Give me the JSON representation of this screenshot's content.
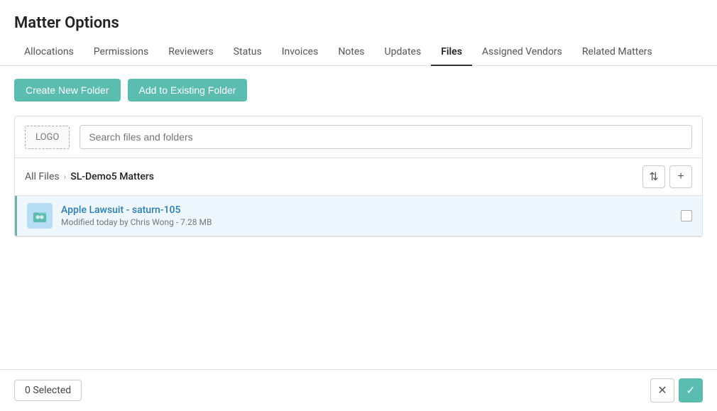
{
  "page": {
    "title": "Matter Options"
  },
  "tabs": {
    "items": [
      {
        "label": "Allocations",
        "active": false
      },
      {
        "label": "Permissions",
        "active": false
      },
      {
        "label": "Reviewers",
        "active": false
      },
      {
        "label": "Status",
        "active": false
      },
      {
        "label": "Invoices",
        "active": false
      },
      {
        "label": "Notes",
        "active": false
      },
      {
        "label": "Updates",
        "active": false
      },
      {
        "label": "Files",
        "active": true
      },
      {
        "label": "Assigned Vendors",
        "active": false
      },
      {
        "label": "Related Matters",
        "active": false
      }
    ]
  },
  "actions": {
    "create_folder_label": "Create New Folder",
    "add_folder_label": "Add to Existing Folder"
  },
  "file_panel": {
    "logo_label": "LOGO",
    "search_placeholder": "Search files and folders",
    "breadcrumb": {
      "root": "All Files",
      "current": "SL-Demo5 Matters"
    },
    "file": {
      "name": "Apple Lawsuit - saturn-105",
      "meta": "Modified today by Chris Wong - 7.28 MB"
    }
  },
  "footer": {
    "selected_count": "0",
    "selected_label": "Selected"
  },
  "icons": {
    "sort": "⇅",
    "plus": "+",
    "close": "✕",
    "check": "✓",
    "chevron": "›"
  }
}
